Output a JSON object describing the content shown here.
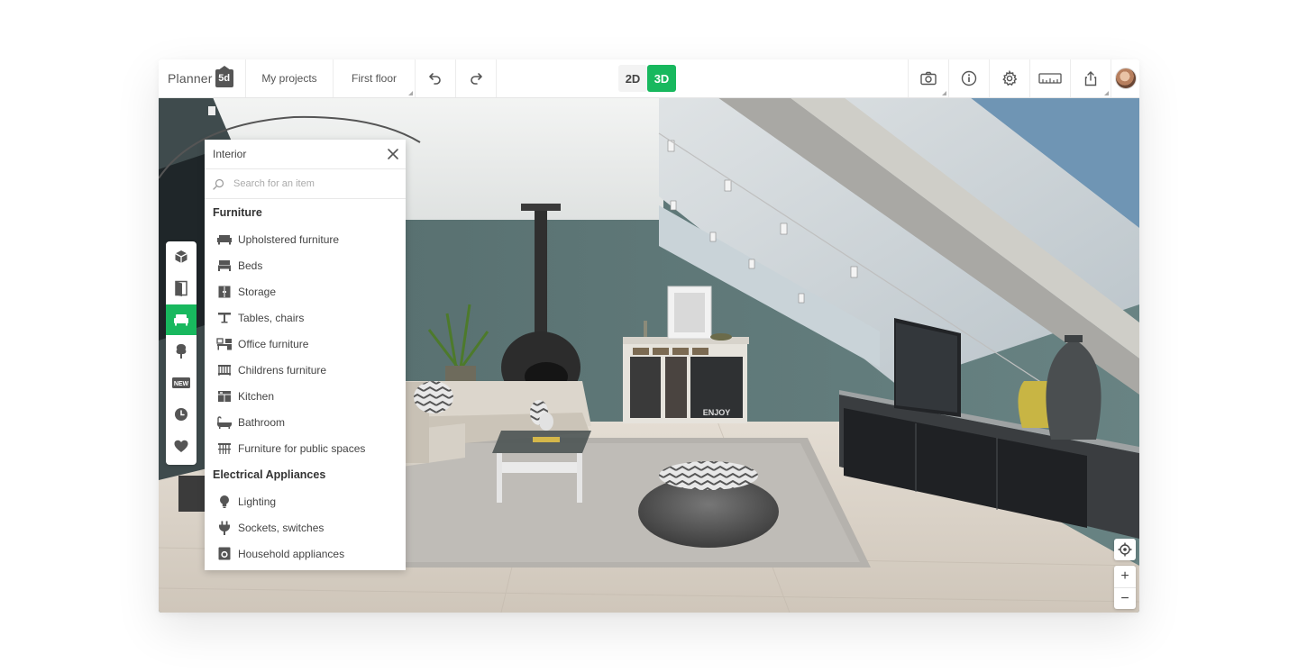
{
  "app": {
    "logo_text": "Planner",
    "logo_badge": "5d"
  },
  "toolbar": {
    "my_projects": "My projects",
    "floor": "First floor",
    "undo_icon": "undo-icon",
    "redo_icon": "redo-icon",
    "mode_2d": "2D",
    "mode_3d": "3D",
    "active_mode": "3D",
    "right_icons": [
      "camera-icon",
      "info-icon",
      "gear-icon",
      "ruler-icon",
      "share-icon",
      "avatar"
    ]
  },
  "rail": {
    "items": [
      {
        "name": "rail-construction",
        "icon": "cube-icon"
      },
      {
        "name": "rail-doors",
        "icon": "door-icon"
      },
      {
        "name": "rail-interior",
        "icon": "sofa-icon",
        "active": true
      },
      {
        "name": "rail-exterior",
        "icon": "tree-icon"
      },
      {
        "name": "rail-new",
        "icon": "new-badge-icon",
        "label": "NEW"
      },
      {
        "name": "rail-recent",
        "icon": "clock-icon"
      },
      {
        "name": "rail-favorites",
        "icon": "heart-icon"
      }
    ]
  },
  "panel": {
    "title": "Interior",
    "search_placeholder": "Search for an item",
    "sections": [
      {
        "title": "Furniture",
        "items": [
          {
            "label": "Upholstered furniture",
            "icon": "sofa-icon"
          },
          {
            "label": "Beds",
            "icon": "bed-icon"
          },
          {
            "label": "Storage",
            "icon": "cabinet-icon"
          },
          {
            "label": "Tables, chairs",
            "icon": "table-icon"
          },
          {
            "label": "Office furniture",
            "icon": "office-desk-icon"
          },
          {
            "label": "Childrens furniture",
            "icon": "crib-icon"
          },
          {
            "label": "Kitchen",
            "icon": "kitchen-icon"
          },
          {
            "label": "Bathroom",
            "icon": "bathtub-icon"
          },
          {
            "label": "Furniture for public spaces",
            "icon": "public-furniture-icon"
          }
        ]
      },
      {
        "title": "Electrical Appliances",
        "items": [
          {
            "label": "Lighting",
            "icon": "bulb-icon"
          },
          {
            "label": "Sockets, switches",
            "icon": "plug-icon"
          },
          {
            "label": "Household appliances",
            "icon": "washer-icon"
          }
        ]
      }
    ]
  },
  "controls": {
    "locate_icon": "target-icon",
    "zoom_in": "+",
    "zoom_out": "−"
  },
  "scene": {
    "cabinet_sign": "ENJOY"
  },
  "colors": {
    "accent": "#18b85e",
    "wall": "#5d7575",
    "ceiling": "#e9ebea",
    "floor": "#d9d2c8"
  }
}
